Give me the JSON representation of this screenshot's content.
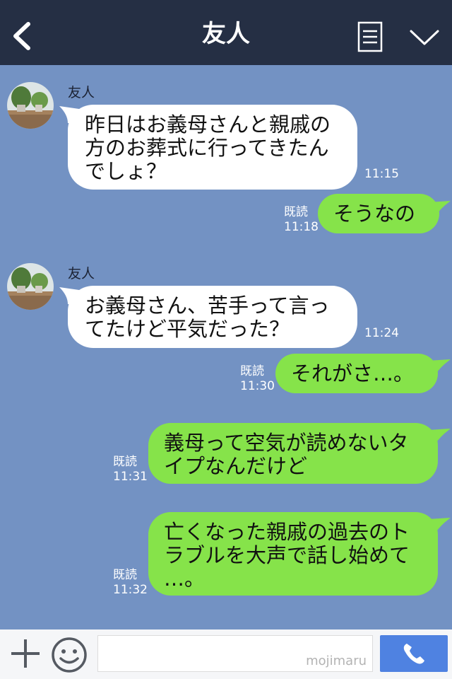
{
  "header": {
    "title": "友人"
  },
  "messages": [
    {
      "side": "left",
      "sender": "友人",
      "text": "昨日はお義母さんと親戚の\n方のお葬式に行ってきたん\nでしょ？",
      "time": "11:15"
    },
    {
      "side": "right",
      "read": "既読",
      "text": "そうなの",
      "time": "11:18"
    },
    {
      "side": "left",
      "sender": "友人",
      "text": "お義母さん、苦手って言っ\nてたけど平気だった？",
      "time": "11:24"
    },
    {
      "side": "right",
      "read": "既読",
      "text": "それがさ…。",
      "time": "11:30"
    },
    {
      "side": "right",
      "read": "既読",
      "text": "義母って空気が読めないタ\nイプなんだけど",
      "time": "11:31"
    },
    {
      "side": "right",
      "read": "既読",
      "text": "亡くなった親戚の過去のト\nラブルを大声で話し始めて\n…。",
      "time": "11:32"
    }
  ],
  "footer": {
    "watermark": "mojimaru"
  },
  "colors": {
    "header": "#252f44",
    "chat_bg": "#7392c3",
    "own_bubble": "#86e34a",
    "call_button": "#4f82e1"
  },
  "icons": [
    "back-icon",
    "menu-icon",
    "chevron-down-icon",
    "plus-icon",
    "smile-icon",
    "phone-icon"
  ]
}
